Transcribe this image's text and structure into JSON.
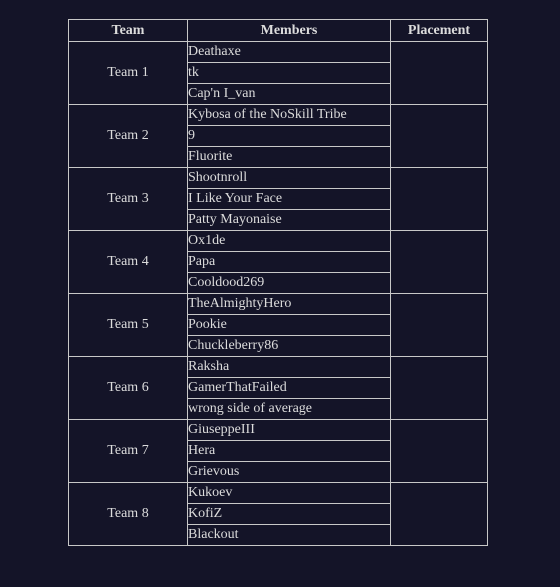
{
  "table": {
    "headers": {
      "team": "Team",
      "members": "Members",
      "placement": "Placement"
    },
    "teams": [
      {
        "name": "Team 1",
        "members": [
          "Deathaxe",
          "tk",
          "Cap'n I_van"
        ],
        "placement": ""
      },
      {
        "name": "Team 2",
        "members": [
          "Kybosa of the NoSkill Tribe",
          "9",
          "Fluorite"
        ],
        "placement": ""
      },
      {
        "name": "Team 3",
        "members": [
          "Shootnroll",
          "I Like Your Face",
          "Patty Mayonaise"
        ],
        "placement": ""
      },
      {
        "name": "Team 4",
        "members": [
          "Ox1de",
          "Papa",
          "Cooldood269"
        ],
        "placement": ""
      },
      {
        "name": "Team 5",
        "members": [
          "TheAlmightyHero",
          "Pookie",
          "Chuckleberry86"
        ],
        "placement": ""
      },
      {
        "name": "Team 6",
        "members": [
          "Raksha",
          "GamerThatFailed",
          "wrong side of average"
        ],
        "placement": ""
      },
      {
        "name": "Team 7",
        "members": [
          "GiuseppeIII",
          "Hera",
          "Grievous"
        ],
        "placement": ""
      },
      {
        "name": "Team 8",
        "members": [
          "Kukoev",
          "KofiZ",
          "Blackout"
        ],
        "placement": ""
      }
    ]
  }
}
